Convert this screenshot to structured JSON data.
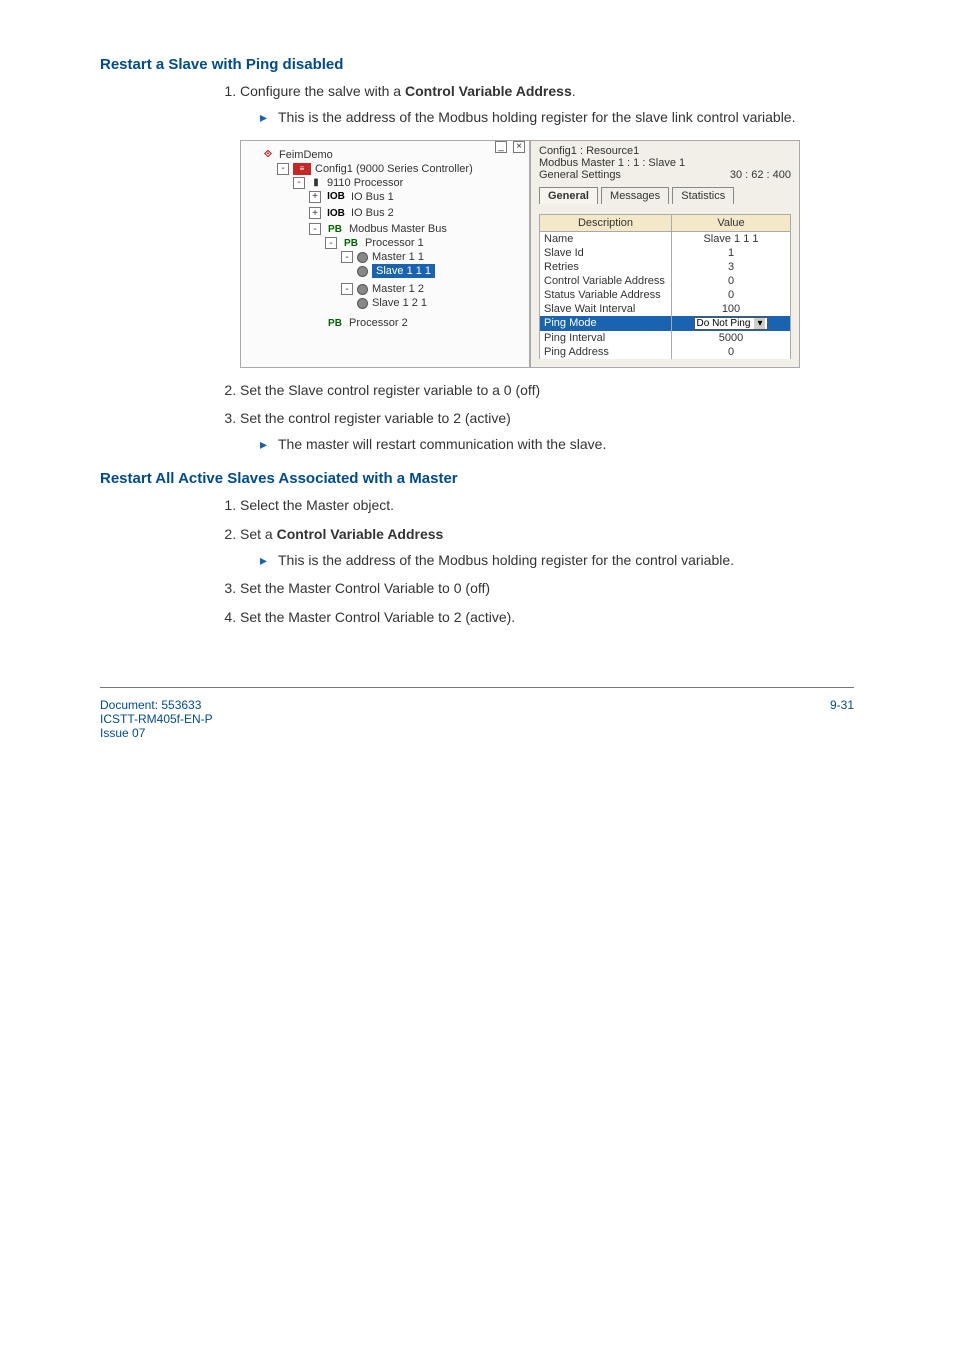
{
  "section1": {
    "title": "Restart a Slave with Ping disabled",
    "step1": "Configure the salve with a ",
    "step1_bold": "Control Variable Address",
    "step1_tail": ".",
    "step1_sub": "This is the address of the Modbus holding register for the slave link control variable.",
    "step2": "Set the Slave control register variable to a 0 (off)",
    "step3": "Set the control register variable to 2 (active)",
    "step3_sub": "The master will restart communication with the slave."
  },
  "section2": {
    "title": "Restart All Active Slaves Associated with a Master",
    "step1": "Select the Master object.",
    "step2": "Set a ",
    "step2_bold": "Control Variable Address",
    "step2_sub": "This is the address of the Modbus holding register for the control variable.",
    "step3": "Set the Master Control Variable to 0 (off)",
    "step4": "Set the Master Control Variable to 2 (active)."
  },
  "tree": {
    "root": "FeimDemo",
    "config": "Config1 (9000 Series Controller)",
    "proc": "9110 Processor",
    "bus1": "IO Bus 1",
    "bus2": "IO Bus 2",
    "modbus": "Modbus Master Bus",
    "p1": "Processor 1",
    "m11": "Master 1 1",
    "s111": "Slave 1 1 1",
    "m12": "Master 1 2",
    "s121": "Slave 1 2 1",
    "p2": "Processor 2"
  },
  "panel": {
    "path1": "Config1 : Resource1",
    "path2": "Modbus Master 1 : 1 : Slave 1",
    "path3": "General Settings",
    "counter": "30 : 62 : 400",
    "tabs": {
      "general": "General",
      "messages": "Messages",
      "stats": "Statistics"
    },
    "cols": {
      "desc": "Description",
      "val": "Value"
    },
    "rows": [
      {
        "d": "Name",
        "v": "Slave 1 1 1"
      },
      {
        "d": "Slave Id",
        "v": "1"
      },
      {
        "d": "Retries",
        "v": "3"
      },
      {
        "d": "Control Variable Address",
        "v": "0"
      },
      {
        "d": "Status Variable Address",
        "v": "0"
      },
      {
        "d": "Slave Wait Interval",
        "v": "100"
      },
      {
        "d": "Ping Mode",
        "v": "Do Not Ping",
        "hl": true,
        "dd": true
      },
      {
        "d": "Ping Interval",
        "v": "5000"
      },
      {
        "d": "Ping Address",
        "v": "0"
      }
    ]
  },
  "footer": {
    "doc": "Document: 553633",
    "code": "ICSTT-RM405f-EN-P",
    "issue": "Issue 07",
    "page": "9-31"
  }
}
